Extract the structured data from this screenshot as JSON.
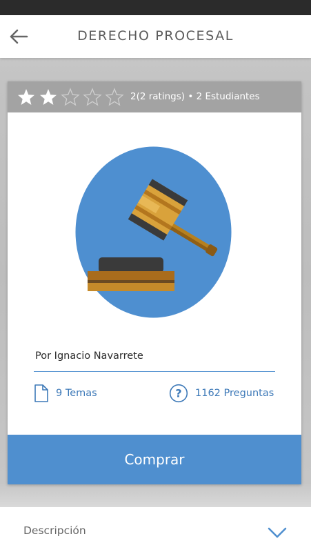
{
  "app_bar": {
    "title": "DERECHO PROCESAL",
    "back_icon": "arrow-left-icon"
  },
  "course": {
    "rating": {
      "stars_filled": 2,
      "stars_total": 5,
      "text": "2(2 ratings) • 2 Estudiantes"
    },
    "image": "gavel-icon",
    "author": "Por Ignacio Navarrete",
    "stats": {
      "temas_label": "9 Temas",
      "temas_icon": "document-icon",
      "preguntas_label": "1162 Preguntas",
      "preguntas_icon": "question-circle-icon"
    },
    "buy_label": "Comprar"
  },
  "description": {
    "label": "Descripción",
    "icon": "chevron-down-icon"
  },
  "colors": {
    "accent": "#4f8fcf",
    "rating_bar": "#a3a3a3",
    "status_bar": "#2b2b2b"
  }
}
